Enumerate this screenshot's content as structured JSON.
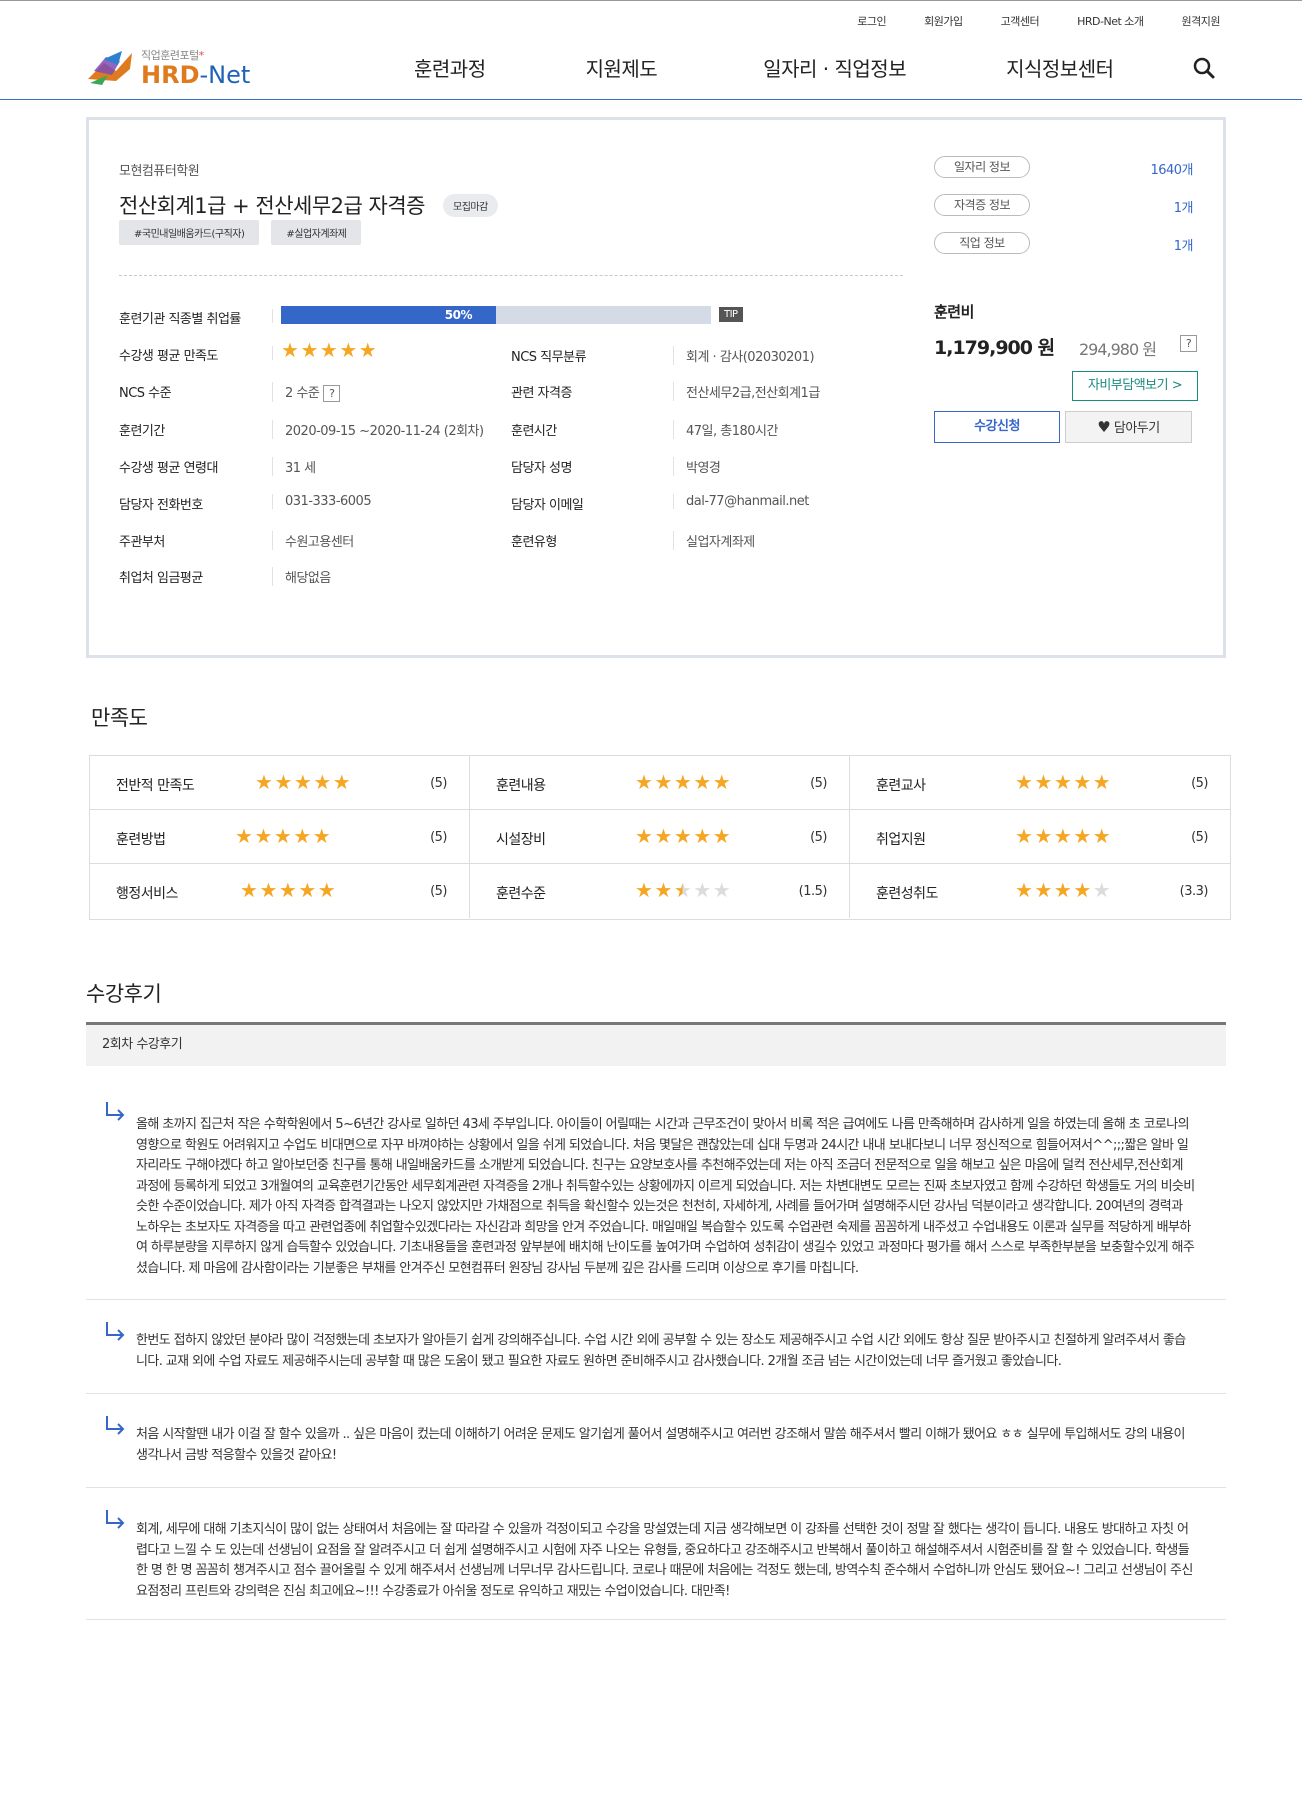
{
  "header": {
    "util_links": [
      "로그인",
      "회원가입",
      "고객센터",
      "HRD-Net 소개",
      "원격지원"
    ],
    "logo": {
      "subtitle": "직업훈련포털",
      "brand_left": "HRD",
      "brand_dash": "-",
      "brand_right": "Net"
    },
    "nav": [
      "훈련과정",
      "지원제도",
      "일자리 · 직업정보",
      "지식정보센터"
    ],
    "accent_color": "#3567c8"
  },
  "course": {
    "institution": "모현컴퓨터학원",
    "title": "전산회계1급 + 전산세무2급 자격증",
    "status_badge": "모집마감",
    "tags": [
      "#국민내일배움카드(구직자)",
      "#실업자계좌제"
    ],
    "employment_rate_label": "훈련기관 직종별 취업률",
    "employment_rate": "50%",
    "employment_rate_value": 0.5,
    "tip_label": "TIP",
    "satisfaction_label": "수강생 평균 만족도",
    "satisfaction_stars": 5,
    "fields": {
      "ncs_level_label": "NCS 수준",
      "ncs_level": "2 수준",
      "period_label": "훈련기간",
      "period": "2020-09-15 ~2020-11-24 (2회차)",
      "age_label": "수강생 평균 연령대",
      "age": "31 세",
      "phone_label": "담당자 전화번호",
      "phone": "031-333-6005",
      "dept_label": "주관부처",
      "dept": "수원고용센터",
      "wage_label": "취업처 임금평균",
      "wage": "해당없음",
      "ncs_class_label": "NCS 직무분류",
      "ncs_class": "회계 · 감사(02030201)",
      "cert_label": "관련 자격증",
      "cert": "전산세무2급,전산회계1급",
      "hours_label": "훈련시간",
      "hours": "47일, 총180시간",
      "manager_label": "담당자 성명",
      "manager": "박영경",
      "email_label": "담당자 이메일",
      "email": "dal-77@hanmail.net",
      "type_label": "훈련유형",
      "type": "실업자계좌제"
    },
    "qmark": "?"
  },
  "side": {
    "links": [
      {
        "label": "일자리 정보",
        "count": "1640개"
      },
      {
        "label": "자격증 정보",
        "count": "1개"
      },
      {
        "label": "직업 정보",
        "count": "1개"
      }
    ],
    "fee_label": "훈련비",
    "fee_total": "1,179,900 원",
    "fee_self": "294,980 원",
    "self_pay_button": "자비부담액보기 >",
    "apply_button": "수강신청",
    "wish_button": "담아두기"
  },
  "satisfaction": {
    "title": "만족도",
    "items": [
      {
        "label": "전반적 만족도",
        "score": 5,
        "display": "(5)"
      },
      {
        "label": "훈련내용",
        "score": 5,
        "display": "(5)"
      },
      {
        "label": "훈련교사",
        "score": 5,
        "display": "(5)"
      },
      {
        "label": "훈련방법",
        "score": 5,
        "display": "(5)"
      },
      {
        "label": "시설장비",
        "score": 5,
        "display": "(5)"
      },
      {
        "label": "취업지원",
        "score": 5,
        "display": "(5)"
      },
      {
        "label": "행정서비스",
        "score": 5,
        "display": "(5)"
      },
      {
        "label": "훈련수준",
        "score": 2.5,
        "display": "(1.5)"
      },
      {
        "label": "훈련성취도",
        "score": 4,
        "display": "(3.3)"
      }
    ]
  },
  "reviews": {
    "title": "수강후기",
    "subheader": "2회차 수강후기",
    "items": [
      "올해 초까지 집근처 작은 수학학원에서 5~6년간 강사로 일하던 43세 주부입니다. 아이들이 어릴때는 시간과 근무조건이 맞아서 비록 적은 급여에도 나름 만족해하며 감사하게 일을 하였는데 올해 초 코로나의 영향으로 학원도 어려워지고 수업도 비대면으로 자꾸 바껴야하는 상황에서 일을 쉬게 되었습니다. 처음 몇달은 괜찮았는데 십대 두명과 24시간 내내 보내다보니 너무 정신적으로 힘들어져서^^;;;짧은 알바 일자리라도 구해야겠다 하고 알아보던중 친구를 통해 내일배움카드를 소개받게 되었습니다. 친구는 요양보호사를 추천해주었는데 저는 아직 조금더 전문적으로 일을 해보고 싶은 마음에 덜컥 전산세무,전산회계 과정에 등록하게 되었고 3개월여의 교육훈련기간동안 세무회계관련 자격증을 2개나 취득할수있는 상황에까지 이르게 되었습니다. 저는 차변대변도 모르는 진짜 초보자였고 함께 수강하던 학생들도 거의 비슷비슷한 수준이었습니다. 제가 아직 자격증 합격결과는 나오지 않았지만 가채점으로 취득을 확신할수 있는것은 천천히, 자세하게, 사례를 들어가며 설명해주시던 강사님 덕분이라고 생각합니다. 20여년의 경력과 노하우는 초보자도 자격증을 따고 관련업종에 취업할수있겠다라는 자신감과 희망을 안겨 주었습니다. 매일매일 복습할수 있도록 수업관련 숙제를 꼼꼼하게 내주셨고 수업내용도 이론과 실무를 적당하게 배부하여 하루분량을 지루하지 않게 습득할수 있었습니다. 기초내용들을 훈련과정 앞부분에 배치해 난이도를 높여가며 수업하여 성취감이 생길수 있었고 과정마다 평가를 해서 스스로 부족한부분을 보충할수있게 해주셨습니다. 제 마음에 감사함이라는 기분좋은 부채를 안겨주신 모현컴퓨터 원장님 강사님 두분께 깊은 감사를 드리며 이상으로 후기를 마칩니다.",
      "한번도 접하지 않았던 분야라 많이 걱정했는데 초보자가 알아듣기 쉽게 강의해주십니다. 수업 시간 외에 공부할 수 있는 장소도 제공해주시고 수업 시간 외에도 항상 질문 받아주시고 친절하게 알려주셔서 좋습니다. 교재 외에 수업 자료도 제공해주시는데 공부할 때 많은 도움이 됐고 필요한 자료도 원하면 준비해주시고 감사했습니다. 2개월 조금 넘는 시간이었는데 너무 즐거웠고 좋았습니다.",
      "처음 시작할땐 내가 이걸 잘 할수 있을까 .. 싶은 마음이 컸는데 이해하기 어려운 문제도 알기쉽게 풀어서 설명해주시고 여러번 강조해서 말씀 해주셔서 빨리 이해가 됐어요 ㅎㅎ 실무에 투입해서도 강의 내용이 생각나서 금방 적응할수 있을것 같아요!",
      "회계, 세무에 대해 기초지식이 많이 없는 상태여서 처음에는 잘 따라갈 수 있을까 걱정이되고 수강을 망설였는데 지금 생각해보면 이 강좌를 선택한 것이 정말 잘 했다는 생각이 듭니다. 내용도 방대하고 자칫 어렵다고 느낄 수 도 있는데 선생님이 요점을 잘 알려주시고 더 쉽게 설명해주시고 시험에 자주 나오는 유형들, 중요하다고 강조해주시고 반복해서 풀이하고 해설해주셔서 시험준비를 잘 할 수 있었습니다. 학생들 한 명 한 명 꼼꼼히 챙겨주시고 점수 끌어올릴 수 있게 해주셔서 선생님께 너무너무 감사드립니다. 코로나 때문에 처음에는 걱정도 했는데, 방역수칙 준수해서 수업하니까 안심도 됐어요~! 그리고 선생님이 주신 요점정리 프린트와 강의력은 진심 최고에요~!!! 수강종료가 아쉬울 정도로 유익하고 재밌는 수업이었습니다. 대만족!"
    ]
  }
}
